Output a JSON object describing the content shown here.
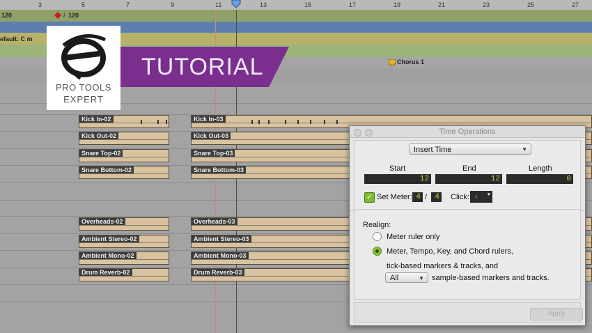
{
  "ruler": {
    "ticks": [
      "3",
      "5",
      "7",
      "9",
      "11",
      "13",
      "15",
      "17",
      "19",
      "21",
      "23",
      "25",
      "27"
    ]
  },
  "tempo": {
    "left_value": "120",
    "marker_value": "120"
  },
  "key_text": "efault: C m",
  "marker": {
    "chorus_label": "Chorus 1"
  },
  "tracks_left": [
    "Kick In-02",
    "Kick Out-02",
    "Snare Top-02",
    "Snare Bottom-02",
    "Overheads-02",
    "Ambient Stereo-02",
    "Ambient Mono-02",
    "Drum Reverb-02"
  ],
  "tracks_right": [
    "Kick In-03",
    "Kick Out-03",
    "Snare Top-03",
    "Snare Bottom-03",
    "Overheads-03",
    "Ambient Stereo-03",
    "Ambient Mono-03",
    "Drum Reverb-03"
  ],
  "overlay": {
    "logo_line1": "PRO TOOLS",
    "logo_line2": "EXPERT",
    "banner": "TUTORIAL"
  },
  "dialog": {
    "title": "Time Operations",
    "operation": "Insert Time",
    "start_label": "Start",
    "end_label": "End",
    "length_label": "Length",
    "start_value": "12",
    "end_value": "12",
    "length_value": "0",
    "set_meter_label": "Set Meter:",
    "meter_num": "4",
    "meter_slash": "/",
    "meter_den": "4",
    "click_label": "Click:",
    "realign_label": "Realign:",
    "option1": "Meter ruler only",
    "option2_line1": "Meter, Tempo, Key, and Chord rulers,",
    "option2_line2": "tick-based markers & tracks, and",
    "all_value": "All",
    "option2_line3": "sample-based markers and tracks.",
    "apply": "Apply"
  },
  "colors": {
    "banner": "#7a2f8f",
    "counter_text": "#b9d63c",
    "radio_selected": "#8cc531"
  }
}
